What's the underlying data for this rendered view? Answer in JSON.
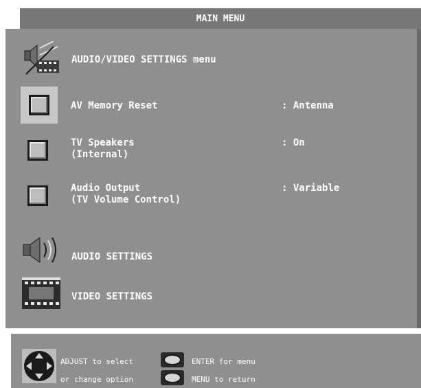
{
  "header": {
    "title": "MAIN MENU"
  },
  "menu": {
    "section_title": "AUDIO/VIDEO SETTINGS menu",
    "items": [
      {
        "label": "AV Memory Reset",
        "value": ": Antenna"
      },
      {
        "label": "TV Speakers",
        "label2": "(Internal)",
        "value": ": On"
      },
      {
        "label": "Audio Output",
        "label2": "(TV Volume Control)",
        "value": ": Variable"
      }
    ],
    "audio_settings": "AUDIO SETTINGS",
    "video_settings": "VIDEO SETTINGS"
  },
  "footer": {
    "adjust_line1": "ADJUST to select",
    "adjust_line2": "or change option",
    "enter_label": "ENTER for menu",
    "menu_label": "MENU to return"
  }
}
